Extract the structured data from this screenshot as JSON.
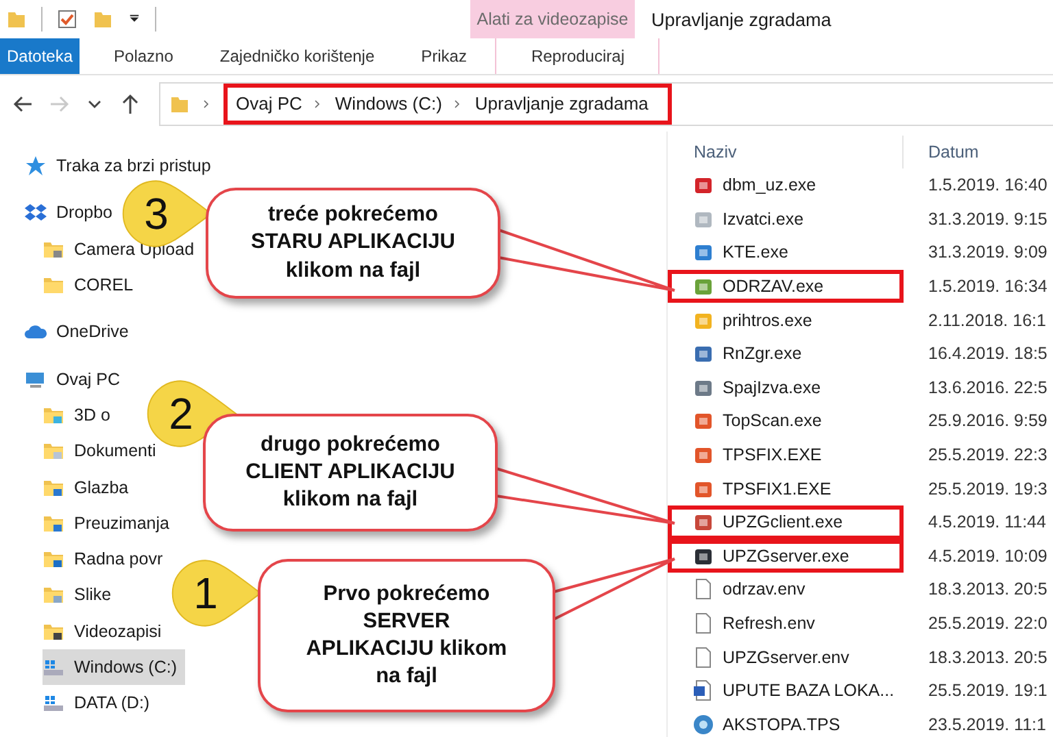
{
  "title_bar": {
    "title": "Upravljanje zgradama",
    "context_group": "Alati za videozapise"
  },
  "ribbon_tabs": [
    {
      "label": "Datoteka",
      "kind": "file"
    },
    {
      "label": "Polazno",
      "kind": "tab"
    },
    {
      "label": "Zajedničko korištenje",
      "kind": "tab"
    },
    {
      "label": "Prikaz",
      "kind": "tab"
    },
    {
      "label": "Reproduciraj",
      "kind": "context"
    }
  ],
  "address_bar": {
    "forward_disabled": true,
    "highlighted": true,
    "path": [
      "Ovaj PC",
      "Windows (C:)",
      "Upravljanje zgradama"
    ]
  },
  "nav_pane": [
    {
      "label": "Traka za brzi pristup",
      "kind": "star",
      "selected": false
    },
    {
      "label": "Dropbo",
      "kind": "dropbox",
      "selected": false,
      "children": [
        {
          "label": "Camera Upload",
          "kind": "camera",
          "selected": false
        },
        {
          "label": "COREL",
          "kind": "folder",
          "selected": false
        }
      ]
    },
    {
      "label": "OneDrive",
      "kind": "cloud",
      "selected": false
    },
    {
      "label": "Ovaj PC",
      "kind": "pc",
      "selected": false,
      "children": [
        {
          "label": "3D o",
          "kind": "folder3d",
          "selected": false
        },
        {
          "label": "Dokumenti",
          "kind": "docs",
          "selected": false
        },
        {
          "label": "Glazba",
          "kind": "music",
          "selected": false
        },
        {
          "label": "Preuzimanja",
          "kind": "download",
          "selected": false
        },
        {
          "label": "Radna povr",
          "kind": "desktop",
          "selected": false
        },
        {
          "label": "Slike",
          "kind": "pictures",
          "selected": false
        },
        {
          "label": "Videozapisi",
          "kind": "video",
          "selected": false
        },
        {
          "label": "Windows (C:)",
          "kind": "drive",
          "selected": true
        },
        {
          "label": "DATA (D:)",
          "kind": "drive",
          "selected": false
        }
      ]
    }
  ],
  "file_list": {
    "columns": [
      "Naziv",
      "Datum"
    ],
    "files": [
      {
        "name": "dbm_uz.exe",
        "date": "1.5.2019. 16:40",
        "kind": "app",
        "highlighted": false
      },
      {
        "name": "Izvatci.exe",
        "date": "31.3.2019. 9:15",
        "kind": "app",
        "highlighted": false
      },
      {
        "name": "KTE.exe",
        "date": "31.3.2019. 9:09",
        "kind": "app",
        "highlighted": false
      },
      {
        "name": "ODRZAV.exe",
        "date": "1.5.2019. 16:34",
        "kind": "app",
        "highlighted": true
      },
      {
        "name": "prihtros.exe",
        "date": "2.11.2018. 16:1",
        "kind": "app",
        "highlighted": false
      },
      {
        "name": "RnZgr.exe",
        "date": "16.4.2019. 18:5",
        "kind": "app",
        "highlighted": false
      },
      {
        "name": "SpajIzva.exe",
        "date": "13.6.2016. 22:5",
        "kind": "app",
        "highlighted": false
      },
      {
        "name": "TopScan.exe",
        "date": "25.9.2016. 9:59",
        "kind": "app",
        "highlighted": false
      },
      {
        "name": "TPSFIX.EXE",
        "date": "25.5.2019. 22:3",
        "kind": "app",
        "highlighted": false
      },
      {
        "name": "TPSFIX1.EXE",
        "date": "25.5.2019. 19:3",
        "kind": "app",
        "highlighted": false
      },
      {
        "name": "UPZGclient.exe",
        "date": "4.5.2019. 11:44",
        "kind": "app",
        "highlighted": true
      },
      {
        "name": "UPZGserver.exe",
        "date": "4.5.2019. 10:09",
        "kind": "app",
        "highlighted": true
      },
      {
        "name": "odrzav.env",
        "date": "18.3.2013. 20:5",
        "kind": "file",
        "highlighted": false
      },
      {
        "name": "Refresh.env",
        "date": "25.5.2019. 22:0",
        "kind": "file",
        "highlighted": false
      },
      {
        "name": "UPZGserver.env",
        "date": "18.3.2013. 20:5",
        "kind": "file",
        "highlighted": false
      },
      {
        "name": "UPUTE  BAZA LOKA...",
        "date": "25.5.2019. 19:1",
        "kind": "word",
        "highlighted": false
      },
      {
        "name": "AKSTOPA.TPS",
        "date": "23.5.2019. 11:1",
        "kind": "tps",
        "highlighted": false
      }
    ]
  },
  "callouts": [
    {
      "number": "3",
      "text": "treće pokrećemo\nSTARU APLIKACIJU\nklikom na fajl"
    },
    {
      "number": "2",
      "text": "drugo pokrećemo\nCLIENT APLIKACIJU\nklikom na fajl"
    },
    {
      "number": "1",
      "text": "Prvo pokrećemo\nSERVER\nAPLIKACIJU klikom\nna fajl"
    }
  ]
}
